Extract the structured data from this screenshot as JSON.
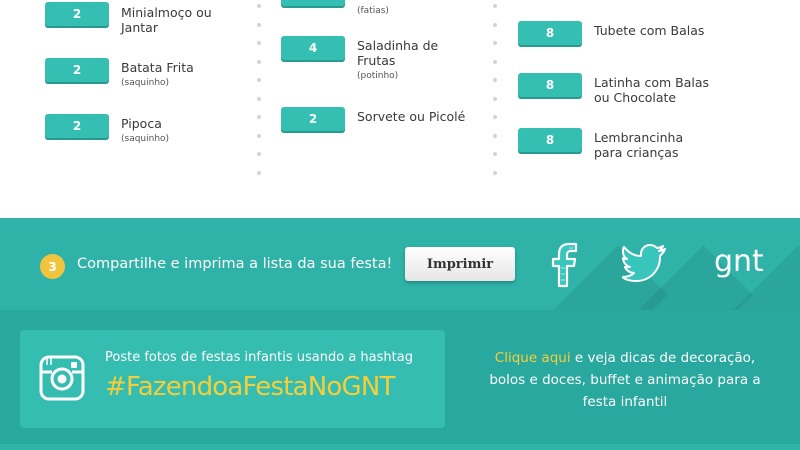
{
  "list": {
    "col1": [
      {
        "qty": "2",
        "name": "Minialmoço ou Jantar",
        "note": ""
      },
      {
        "qty": "2",
        "name": "Batata Frita",
        "note": "(saquinho)"
      },
      {
        "qty": "2",
        "name": "Pipoca",
        "note": "(saquinho)"
      }
    ],
    "col2": [
      {
        "qty": "",
        "name": "",
        "note": "(fatias)"
      },
      {
        "qty": "4",
        "name": "Saladinha de Frutas",
        "note": "(potinho)"
      },
      {
        "qty": "2",
        "name": "Sorvete ou Picolé",
        "note": ""
      }
    ],
    "col3": [
      {
        "qty": "8",
        "name": "Tubete com Balas",
        "note": ""
      },
      {
        "qty": "8",
        "name": "Latinha com Balas ou Chocolate",
        "note": ""
      },
      {
        "qty": "8",
        "name": "Lembrancinha para crianças",
        "note": ""
      }
    ]
  },
  "share": {
    "step": "3",
    "text": "Compartilhe e imprima a lista da sua festa!",
    "print_label": "Imprimir",
    "facebook_icon": "facebook-icon",
    "twitter_icon": "twitter-icon",
    "brand_logo": "gnt"
  },
  "instagram": {
    "icon": "instagram-icon",
    "line1": "Poste fotos de festas infantis usando a hashtag",
    "hashtag": "#FazendoaFestaNoGNT"
  },
  "tips": {
    "link": "Clique aqui",
    "text": " e veja dicas de decoração, bolos e doces, buffet e animação para a festa infantil"
  },
  "colors": {
    "teal": "#2fb3a8",
    "teal_dark": "#28a89e",
    "qty_badge": "#35bfb3",
    "accent_yellow": "#f5cf3a"
  }
}
